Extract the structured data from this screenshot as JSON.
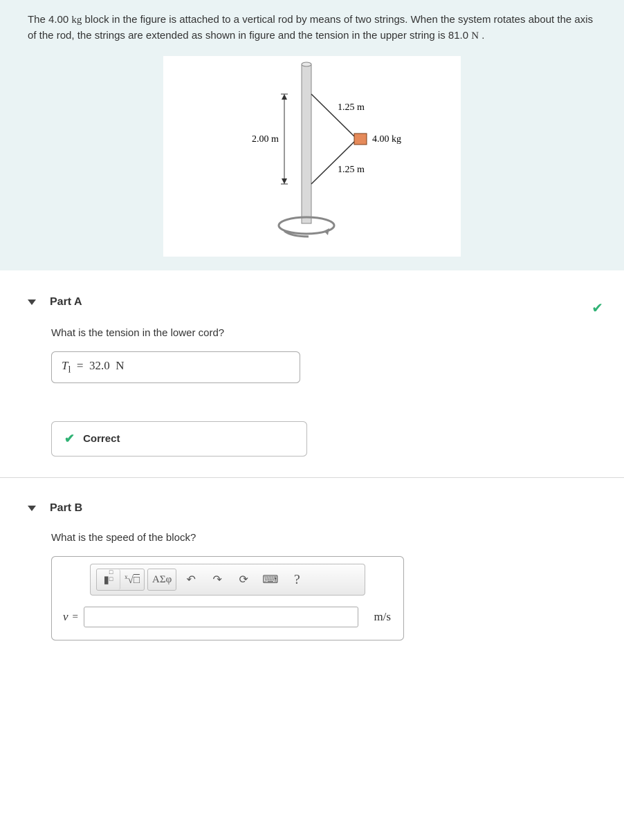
{
  "problem": {
    "text_prefix": "The 4.00 ",
    "unit_kg": "kg",
    "text_mid1": " block in the figure is attached to a vertical rod by means of two strings. When the system rotates about the axis of the rod, the strings are extended as shown in figure and the tension in the upper string is 81.0 ",
    "unit_N": "N",
    "text_suffix": " ."
  },
  "figure": {
    "rod_height_label": "2.00 m",
    "upper_string_label": "1.25 m",
    "lower_string_label": "1.25 m",
    "mass_label": "4.00 kg"
  },
  "partA": {
    "title": "Part A",
    "question": "What is the tension in the lower cord?",
    "var": "T",
    "sub": "l",
    "eq": "=",
    "value": "32.0",
    "unit": "N",
    "status": "Correct"
  },
  "partB": {
    "title": "Part B",
    "question": "What is the speed of the block?",
    "var": "v",
    "eq": "=",
    "unit": "m/s",
    "value": "",
    "toolbar": {
      "templates": "▮",
      "radical": "√",
      "greek": "ΑΣφ",
      "undo": "↶",
      "redo": "↷",
      "reset": "⟳",
      "keyboard": "⌨",
      "help": "?"
    }
  }
}
